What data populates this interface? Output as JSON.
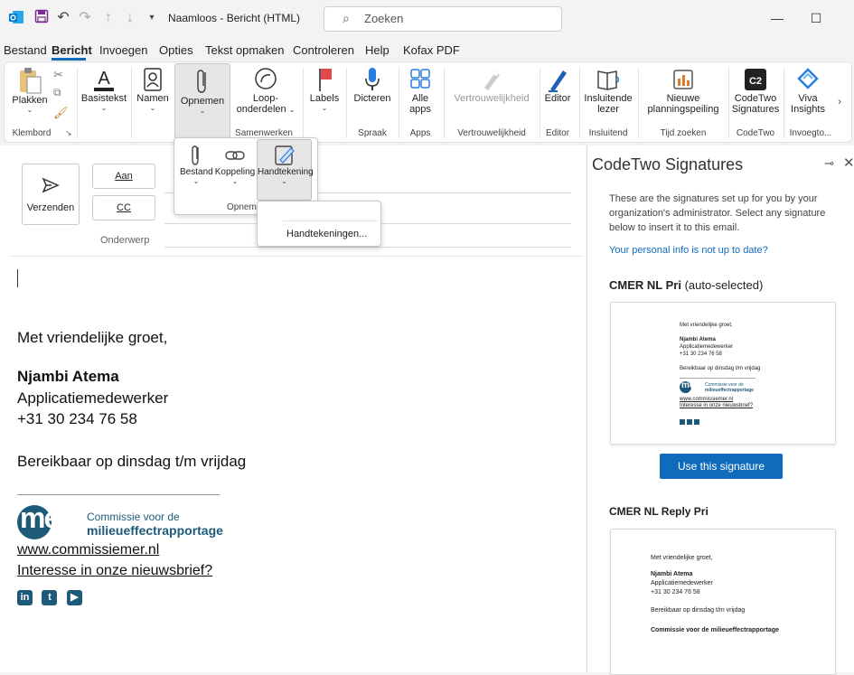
{
  "titlebar": {
    "title": "Naamloos  -  Bericht (HTML)",
    "search_placeholder": "Zoeken",
    "icons": [
      "outlook-icon",
      "save-icon",
      "undo-icon",
      "redo-icon",
      "up-icon",
      "down-icon",
      "customize-icon"
    ]
  },
  "menu": [
    "Bestand",
    "Bericht",
    "Invoegen",
    "Opties",
    "Tekst opmaken",
    "Controleren",
    "Help",
    "Kofax PDF"
  ],
  "ribbon": {
    "paste": "Plakken",
    "clipboard_group": "Klembord",
    "basistekst": "Basistekst",
    "namen": "Namen",
    "opnemen": "Opnemen",
    "loop_1": "Loop-",
    "loop_2": "onderdelen",
    "samenwerken_group": "Samenwerken",
    "labels": "Labels",
    "dicteren": "Dicteren",
    "spraak_group": "Spraak",
    "alle_1": "Alle",
    "alle_2": "apps",
    "apps_group": "Apps",
    "vertrouw": "Vertrouwelijkheid",
    "vertrouw_group": "Vertrouwelijkheid",
    "editor": "Editor",
    "editor_group": "Editor",
    "insl_1": "Insluitende",
    "insl_2": "lezer",
    "insl_group": "Insluitend",
    "planning_1": "Nieuwe",
    "planning_2": "planningspeiling",
    "tijd_group": "Tijd zoeken",
    "codetwo_1": "CodeTwo",
    "codetwo_2": "Signatures",
    "codetwo_group": "CodeTwo",
    "viva_1": "Viva",
    "viva_2": "Insights",
    "invoeg_group": "Invoegto..."
  },
  "opnemen_dropdown": {
    "bestand": "Bestand",
    "koppeling": "Koppeling",
    "handtekening": "Handtekening",
    "group": "Opneme"
  },
  "signature_menu": {
    "item": "Handtekeningen..."
  },
  "compose": {
    "send": "Verzenden",
    "to": "Aan",
    "cc": "CC",
    "subject": "Onderwerp",
    "greeting": "Met vriendelijke groet,",
    "name": "Njambi Atema",
    "role": "Applicatiemedewerker",
    "phone": "+31 30 234 76 58",
    "availability": "Bereikbaar op dinsdag t/m vrijdag",
    "logo_mark": "mer",
    "logo_line1": "Commissie voor de",
    "logo_line2": "milieueffectrapportage",
    "website": "www.commissiemer.nl",
    "newsletter": "Interesse in onze nieuwsbrief?",
    "social": [
      "in",
      "t",
      "▶"
    ]
  },
  "pane": {
    "title": "CodeTwo Signatures",
    "intro": "These are the signatures set up for you by your organization's administrator. Select any signature below to insert it to this email.",
    "info_link": "Your personal info is not up to date?",
    "sig1_name": "CMER NL Pri",
    "sig1_suffix": "(auto-selected)",
    "use_button": "Use this signature",
    "sig2_name": "CMER NL Reply Pri",
    "preview": {
      "greeting": "Met vriendelijke groet,",
      "name": "Njambi Atema",
      "role": "Applicatiemedewerker",
      "phone": "+31 30 234 76 58",
      "availability": "Bereikbaar op dinsdag t/m vrijdag",
      "logo_mark": "mer",
      "logo_line1": "Commissie voor de",
      "logo_line2": "milieueffectrapportage",
      "website": "www.commissiemer.nl",
      "newsletter": "Interesse in onze nieuwsbrief?",
      "org": "Commissie voor de milieueffectrapportage"
    }
  },
  "colors": {
    "accent": "#0f6cbd",
    "brand": "#1d5a7a",
    "outlook": "#0078d4"
  }
}
